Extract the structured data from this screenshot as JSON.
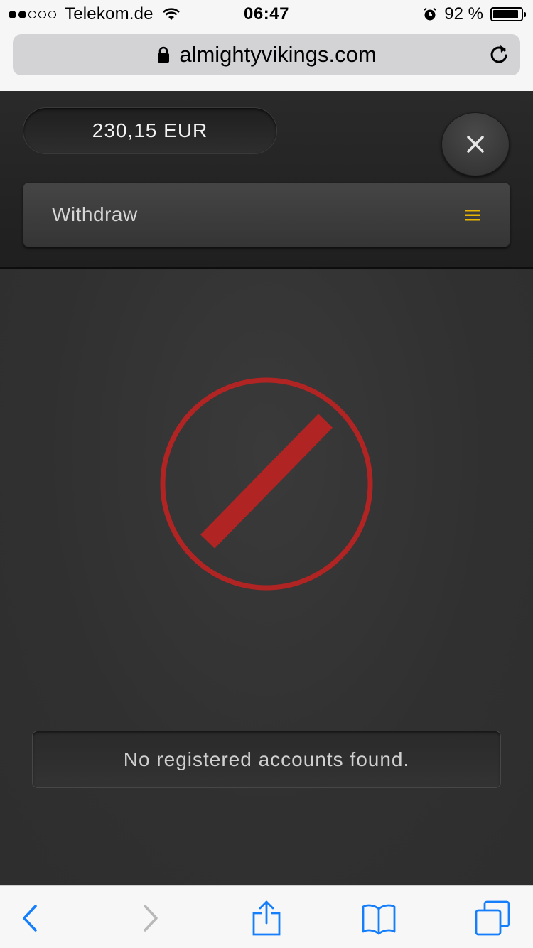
{
  "status_bar": {
    "carrier": "Telekom.de",
    "time": "06:47",
    "battery_percent": "92 %",
    "battery_level": 0.92,
    "signal_bars_filled": 2,
    "signal_bars_total": 5
  },
  "browser": {
    "url": "almightyvikings.com"
  },
  "header": {
    "balance": "230,15 EUR",
    "dropdown_selected": "Withdraw"
  },
  "main": {
    "status_icon": "no-entry-icon",
    "message": "No registered accounts found."
  },
  "toolbar": {
    "back_icon": "back-arrow-icon",
    "forward_icon": "forward-arrow-icon",
    "share_icon": "share-icon",
    "bookmarks_icon": "bookmarks-icon",
    "tabs_icon": "tabs-icon"
  },
  "colors": {
    "accent_red": "#b02423",
    "menu_icon_yellow": "#e8b400",
    "ios_blue": "#147efb"
  }
}
